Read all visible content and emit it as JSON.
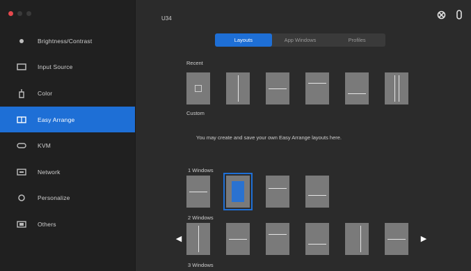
{
  "window": {
    "traffic_colors": [
      "#e5484d",
      "#3a3a3a",
      "#3a3a3a"
    ],
    "title": "U34"
  },
  "sidebar": {
    "items": [
      {
        "label": "Brightness/Contrast",
        "icon": "brightness-icon",
        "active": false
      },
      {
        "label": "Input Source",
        "icon": "input-source-icon",
        "active": false
      },
      {
        "label": "Color",
        "icon": "color-icon",
        "active": false
      },
      {
        "label": "Easy Arrange",
        "icon": "easy-arrange-icon",
        "active": true
      },
      {
        "label": "KVM",
        "icon": "kvm-icon",
        "active": false
      },
      {
        "label": "Network",
        "icon": "network-icon",
        "active": false
      },
      {
        "label": "Personalize",
        "icon": "personalize-icon",
        "active": false
      },
      {
        "label": "Others",
        "icon": "others-icon",
        "active": false
      }
    ]
  },
  "top_icons": [
    "settings-icon",
    "info-icon"
  ],
  "tabs": [
    {
      "label": "Layouts",
      "active": true
    },
    {
      "label": "App Windows",
      "active": false
    },
    {
      "label": "Profiles",
      "active": false
    }
  ],
  "sections": {
    "recent": "Recent",
    "custom": "Custom",
    "custom_message": "You may create and save your own Easy Arrange layouts here.",
    "one_window": "1 Windows",
    "two_window": "2 Windows",
    "three_window": "3 Windows"
  },
  "colors": {
    "accent": "#1e6fd6",
    "sidebar_bg": "#202020",
    "content_bg": "#2b2b2b",
    "tile": "#7a7a7a"
  }
}
